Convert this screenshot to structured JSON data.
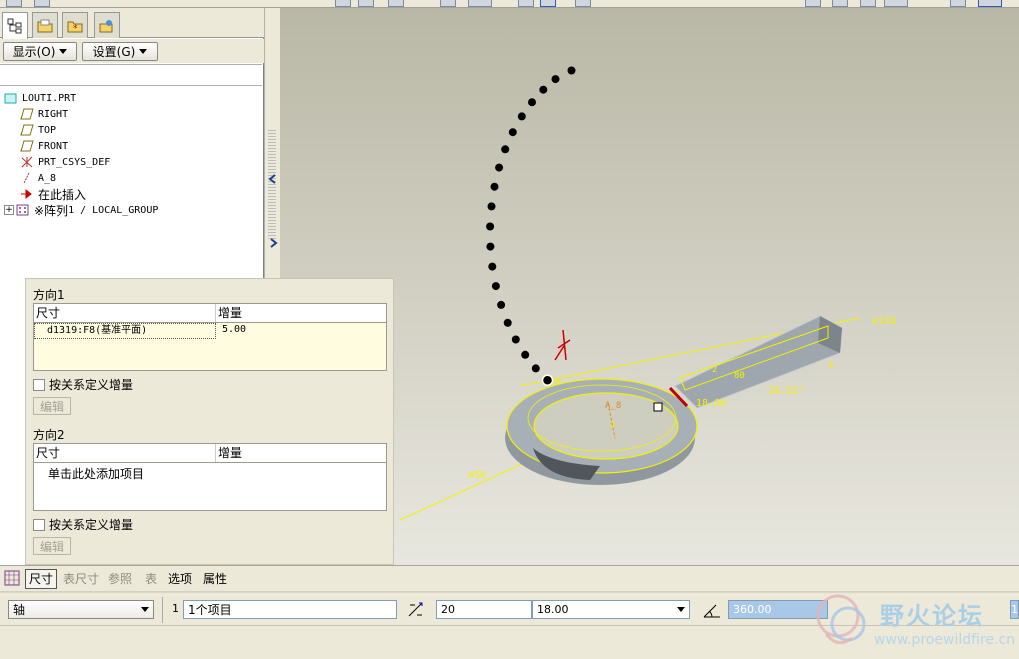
{
  "model_tree": {
    "show_label": "显示(O)",
    "settings_label": "设置(G)",
    "items": [
      {
        "label": "LOUTI.PRT",
        "icon": "part-icon"
      },
      {
        "label": "RIGHT",
        "icon": "datum-plane-icon"
      },
      {
        "label": "TOP",
        "icon": "datum-plane-icon"
      },
      {
        "label": "FRONT",
        "icon": "datum-plane-icon"
      },
      {
        "label": "PRT_CSYS_DEF",
        "icon": "csys-icon"
      },
      {
        "label": "A_8",
        "icon": "axis-icon"
      },
      {
        "label": "在此插入",
        "icon": "insert-here-arrow-icon"
      },
      {
        "prefix": "※阵列",
        "label": " 1 / LOCAL_GROUP",
        "icon": "pattern-icon"
      }
    ]
  },
  "pattern": {
    "direction1": {
      "title": "方向1",
      "col_dim": "尺寸",
      "col_inc": "增量",
      "row_dim": "d1319:F8(基准平面)",
      "row_inc": "5.00"
    },
    "relation_label": "按关系定义增量",
    "edit_label": "编辑",
    "direction2": {
      "title": "方向2",
      "col_dim": "尺寸",
      "col_inc": "增量",
      "placeholder": "单击此处添加项目"
    }
  },
  "dashboard": {
    "tabs": [
      "尺寸",
      "表尺寸",
      "参照",
      "表",
      "选项",
      "属性"
    ],
    "type_value": "轴",
    "first_dir_num": "1",
    "first_dir_items": "1个项目",
    "count_value": "20",
    "spacing_value": "18.00",
    "angle_value": "360.00",
    "small_value": "1"
  },
  "viewport": {
    "dims": {
      "d120": "⌀120",
      "d40": "⌀40",
      "d50": "⌀50",
      "angle": "29.51°",
      "val": "18.00",
      "axis": "A_8",
      "r2": "2",
      "r80": "80",
      "r5": "5",
      "r4": "4"
    }
  },
  "watermark": {
    "title": "野火论坛",
    "url": "www.proewildfire.cn"
  },
  "colors": {
    "dim_yellow": "#f2f200",
    "model_gray": "#9ea6ae",
    "axis_orange": "#e88b1c"
  }
}
